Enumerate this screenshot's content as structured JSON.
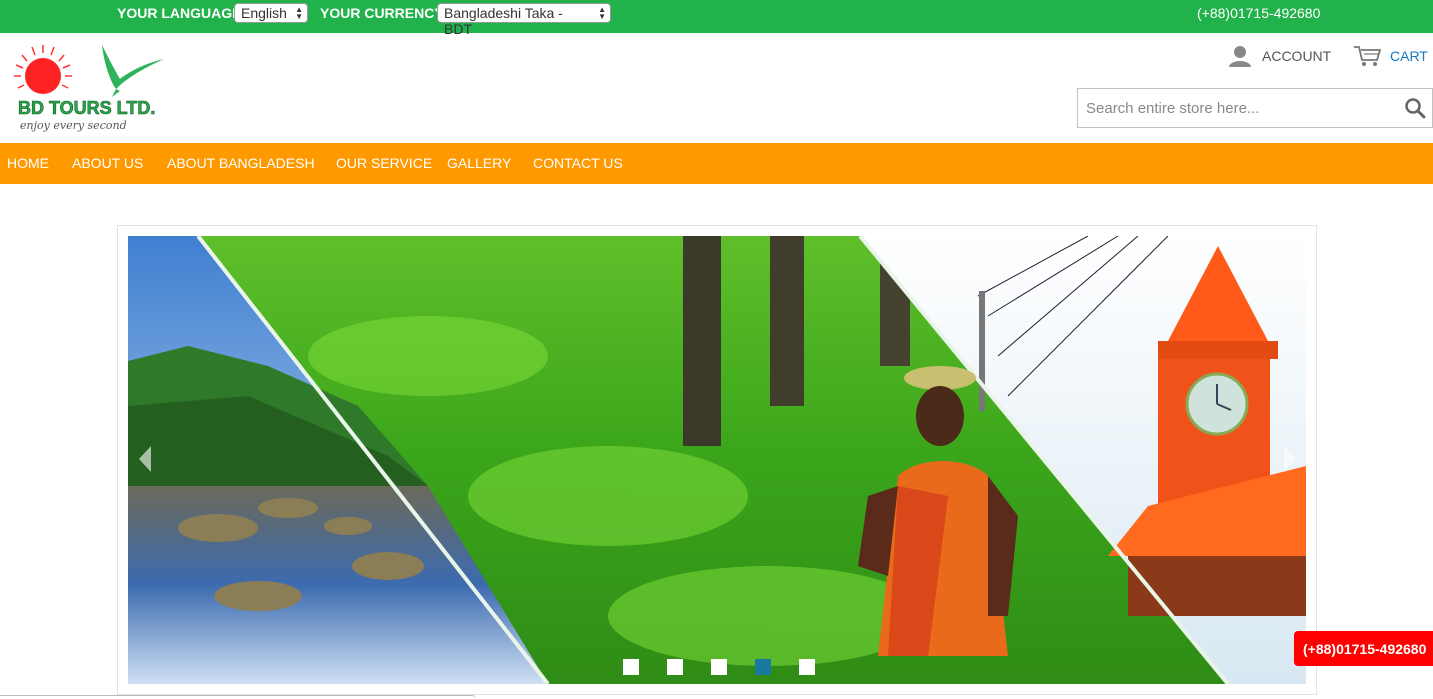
{
  "topbar": {
    "language_label": "YOUR LANGUAGE:",
    "language_value": "English",
    "currency_label": "YOUR CURRENCY:",
    "currency_value": "Bangladeshi Taka - BDT",
    "phone": "(+88)01715-492680",
    "color": "#22b24c"
  },
  "logo": {
    "title": "BD TOURS LTD.",
    "tagline": "enjoy every second",
    "icons": [
      "sun-icon",
      "bird-icon"
    ]
  },
  "header": {
    "account_label": "ACCOUNT",
    "cart_label": "CART",
    "search_placeholder": "Search entire store here...",
    "icons": [
      "user-icon",
      "cart-icon",
      "search-icon"
    ]
  },
  "nav": {
    "color": "#ff9900",
    "items": [
      {
        "label": "HOME"
      },
      {
        "label": "ABOUT US"
      },
      {
        "label": "ABOUT BANGLADESH"
      },
      {
        "label": "OUR SERVICE"
      },
      {
        "label": "GALLERY"
      },
      {
        "label": "CONTACT US"
      }
    ]
  },
  "slider": {
    "slide_count": 5,
    "active_slide": 4,
    "icons": [
      "chevron-left-icon",
      "chevron-right-icon"
    ]
  },
  "float_phone": "(+88)01715-492680"
}
